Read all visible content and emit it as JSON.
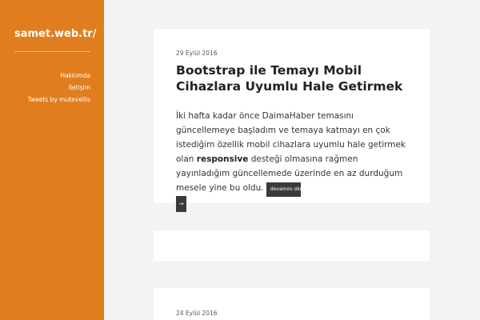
{
  "sidebar": {
    "site_title": "samet.web.tr/",
    "nav_items": [
      "Hakkımda",
      "İletişim",
      "Tweets by mutevellis"
    ],
    "background_color": "#e07e1f"
  },
  "posts": [
    {
      "date": "29 Eylül 2016",
      "title": "Bootstrap ile Temayı Mobil Cihazlara Uyumlu Hale Getirmek",
      "excerpt_before": "İki hafta kadar önce DaimaHaber temasını güncellemeye başladım ve temaya katmayı en çok istediğim özellik mobil cihazlara uyumlu hale getirmek olan ",
      "excerpt_bold": "responsive",
      "excerpt_after": " desteği olmasına rağmen yayınladığım güncellemede üzerinde en az durduğum mesele yine bu oldu. ",
      "read_more_label": "devamını oku",
      "read_more_arrow": "→"
    },
    {
      "date": "24 Eylül 2016"
    }
  ]
}
